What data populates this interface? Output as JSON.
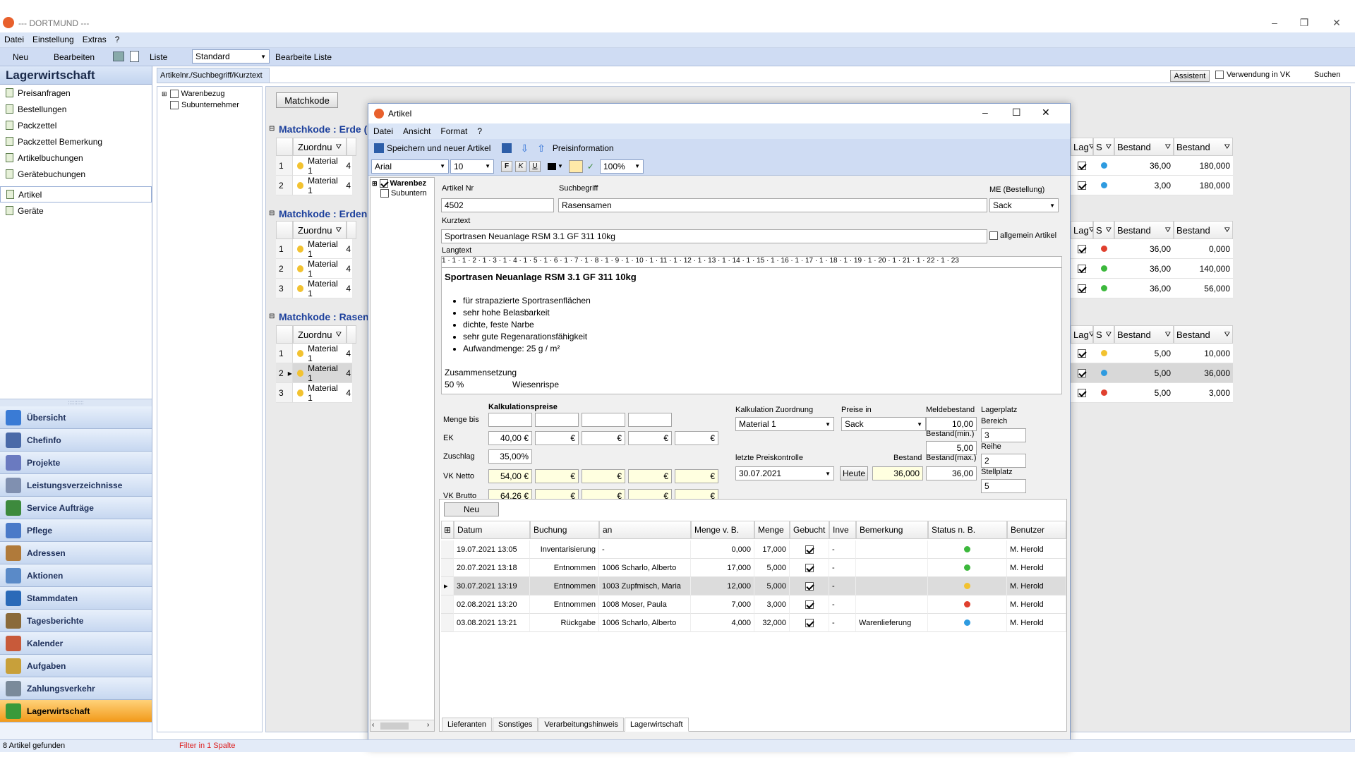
{
  "app": {
    "title": "--- DORTMUND ---",
    "menu": [
      "Datei",
      "Einstellung",
      "Extras",
      "?"
    ],
    "toolbar": {
      "new": "Neu",
      "edit": "Bearbeiten",
      "list": "Liste",
      "view_combo": "Standard",
      "edit_list": "Bearbeite Liste"
    },
    "window_controls": {
      "minimize": "–",
      "restore": "❐",
      "close": "✕"
    }
  },
  "left_panel": {
    "title": "Lagerwirtschaft",
    "tree": [
      "Preisanfragen",
      "Bestellungen",
      "Packzettel",
      "Packzettel Bemerkung",
      "Artikelbuchungen",
      "Gerätebuchungen",
      "Artikel",
      "Geräte"
    ],
    "selected_index": 6,
    "splitter": "::::::::::",
    "nav": [
      {
        "label": "Übersicht",
        "color": "#3a7bd5"
      },
      {
        "label": "Chefinfo",
        "color": "#4a6aa8"
      },
      {
        "label": "Projekte",
        "color": "#6a7ac0"
      },
      {
        "label": "Leistungsverzeichnisse",
        "color": "#8090b0"
      },
      {
        "label": "Service Aufträge",
        "color": "#3d8a3d"
      },
      {
        "label": "Pflege",
        "color": "#4a7ac8"
      },
      {
        "label": "Adressen",
        "color": "#b07a3a"
      },
      {
        "label": "Aktionen",
        "color": "#5a8ac8"
      },
      {
        "label": "Stammdaten",
        "color": "#2a6ab8"
      },
      {
        "label": "Tagesberichte",
        "color": "#8a6a3a"
      },
      {
        "label": "Kalender",
        "color": "#c85a3a"
      },
      {
        "label": "Aufgaben",
        "color": "#c8a03a"
      },
      {
        "label": "Zahlungsverkehr",
        "color": "#7a8a9a"
      },
      {
        "label": "Lagerwirtschaft",
        "color": "#3a9a3a"
      }
    ],
    "active_nav_index": 13
  },
  "search_bar": {
    "label": "Artikelnr./Suchbegriff/Kurztext",
    "assistant": "Assistent",
    "use_in_vk": "Verwendung in VK",
    "search": "Suchen"
  },
  "mid_tree": [
    "Warenbezug",
    "Subunternehmer"
  ],
  "main_grid": {
    "tab": "Matchkode",
    "right_headers": [
      "Lag",
      "S",
      "Bestand",
      "Bestand"
    ],
    "groups": [
      {
        "title": "Matchkode : Erde (",
        "header": "Zuordnu",
        "rows": [
          {
            "n": "1",
            "mat": "Material 1",
            "dot": "#f2c230",
            "s": "#2e9be0",
            "b1": "36,00",
            "b2": "180,000"
          },
          {
            "n": "2",
            "mat": "Material 1",
            "dot": "#f2c230",
            "s": "#2e9be0",
            "b1": "3,00",
            "b2": "180,000"
          }
        ]
      },
      {
        "title": "Matchkode : Erden",
        "header": "Zuordnu",
        "rows": [
          {
            "n": "1",
            "mat": "Material 1",
            "dot": "#f2c230",
            "s": "#e0402e",
            "b1": "36,00",
            "b2": "0,000"
          },
          {
            "n": "2",
            "mat": "Material 1",
            "dot": "#f2c230",
            "s": "#3cb83c",
            "b1": "36,00",
            "b2": "140,000"
          },
          {
            "n": "3",
            "mat": "Material 1",
            "dot": "#f2c230",
            "s": "#3cb83c",
            "b1": "36,00",
            "b2": "56,000"
          }
        ]
      },
      {
        "title": "Matchkode : Rasen",
        "header": "Zuordnu",
        "rows": [
          {
            "n": "1",
            "mat": "Material 1",
            "dot": "#f2c230",
            "s": "#f2c230",
            "b1": "5,00",
            "b2": "10,000"
          },
          {
            "n": "2",
            "mat": "Material 1",
            "dot": "#f2c230",
            "s": "#2e9be0",
            "b1": "5,00",
            "b2": "36,000"
          },
          {
            "n": "3",
            "mat": "Material 1",
            "dot": "#f2c230",
            "s": "#e0402e",
            "b1": "5,00",
            "b2": "3,000"
          }
        ]
      }
    ],
    "cut_col": "4"
  },
  "dialog": {
    "title": "Artikel",
    "menu": [
      "Datei",
      "Ansicht",
      "Format",
      "?"
    ],
    "toolbar": {
      "save_new": "Speichern und neuer Artikel",
      "price_info": "Preisinformation"
    },
    "format": {
      "font": "Arial",
      "size": "10",
      "bold": "F",
      "italic": "K",
      "underline": "U",
      "zoom": "100%"
    },
    "tree": [
      "Warenbez",
      "Subuntern"
    ],
    "fields": {
      "artikel_nr_label": "Artikel Nr",
      "artikel_nr": "4502",
      "suchbegriff_label": "Suchbegriff",
      "suchbegriff": "Rasensamen",
      "me_label": "ME (Bestellung)",
      "me": "Sack",
      "kurztext_label": "Kurztext",
      "kurztext": "Sportrasen Neuanlage RSM 3.1 GF 311 10kg",
      "allgemein": "allgemein Artikel",
      "langtext_label": "Langtext"
    },
    "ruler": "1 · 1 · 1 · 2 · 1 · 3 · 1 · 4 · 1 · 5 · 1 · 6 · 1 · 7 · 1 · 8 · 1 · 9 · 1 · 10 · 1 · 11 · 1 · 12 · 1 · 13 · 1 · 14 · 1 · 15 · 1 · 16 · 1 · 17 · 1 · 18 · 1 · 19 · 1 · 20 · 1 · 21 · 1 · 22 · 1 · 23",
    "langtext": {
      "heading": "Sportrasen Neuanlage RSM 3.1 GF 311 10kg",
      "bullets": [
        "für strapazierte Sportrasenflächen",
        "sehr hohe Belasbarkeit",
        "dichte, feste Narbe",
        "sehr gute Regenarationsfähigkeit",
        "Aufwandmenge: 25 g / m²"
      ],
      "section": "Zusammensetzung",
      "comp_pct": "50 %",
      "comp_name": "Wiesenrispe"
    },
    "calc": {
      "title": "Kalkulationspreise",
      "rows": [
        "Menge bis",
        "EK",
        "Zuschlag",
        "VK Netto",
        "VK Brutto"
      ],
      "ek": "40,00 €",
      "zuschlag": "35,00%",
      "vk_netto": "54,00 €",
      "vk_brutto": "64,26 €",
      "euro": "€",
      "kalk_label": "Kalkulation Zuordnung",
      "kalk": "Material 1",
      "preise_label": "Preise in",
      "preise": "Sack",
      "letzte_label": "letzte Preiskontrolle",
      "letzte": "30.07.2021",
      "heute": "Heute",
      "bestand_label": "Bestand",
      "bestand": "36,000",
      "melde_label": "Meldebestand",
      "melde": "10,00",
      "min_label": "Bestand(min.)",
      "min": "5,00",
      "max_label": "Bestand(max.)",
      "max": "36,00",
      "lager_label": "Lagerplatz",
      "bereich_label": "Bereich",
      "bereich": "3",
      "reihe_label": "Reihe",
      "reihe": "2",
      "stell_label": "Stellplatz",
      "stell": "5"
    },
    "bookings": {
      "new_btn": "Neu",
      "headers": [
        "Datum",
        "Buchung",
        "an",
        "Menge v. B.",
        "Menge",
        "Gebucht",
        "Inve",
        "Bemerkung",
        "Status n. B.",
        "Benutzer"
      ],
      "rows": [
        {
          "datum": "19.07.2021 13:05",
          "buchung": "Inventarisierung",
          "an": "-",
          "mvb": "0,000",
          "menge": "17,000",
          "inve": "-",
          "bem": "",
          "status": "#3cb83c",
          "user": "M. Herold"
        },
        {
          "datum": "20.07.2021 13:18",
          "buchung": "Entnommen",
          "an": "1006 Scharlo, Alberto",
          "mvb": "17,000",
          "menge": "5,000",
          "inve": "-",
          "bem": "",
          "status": "#3cb83c",
          "user": "M. Herold"
        },
        {
          "datum": "30.07.2021 13:19",
          "buchung": "Entnommen",
          "an": "1003 Zupfmisch, Maria",
          "mvb": "12,000",
          "menge": "5,000",
          "inve": "-",
          "bem": "",
          "status": "#f2c230",
          "user": "M. Herold"
        },
        {
          "datum": "02.08.2021 13:20",
          "buchung": "Entnommen",
          "an": "1008 Moser, Paula",
          "mvb": "7,000",
          "menge": "3,000",
          "inve": "-",
          "bem": "",
          "status": "#e0402e",
          "user": "M. Herold"
        },
        {
          "datum": "03.08.2021 13:21",
          "buchung": "Rückgabe",
          "an": "1006 Scharlo, Alberto",
          "mvb": "4,000",
          "menge": "32,000",
          "inve": "-",
          "bem": "Warenlieferung",
          "status": "#2e9be0",
          "user": "M. Herold"
        }
      ],
      "selected_row": 2
    },
    "tabs": [
      "Lieferanten",
      "Sonstiges",
      "Verarbeitungshinweis",
      "Lagerwirtschaft"
    ],
    "selected_tab": 3
  },
  "status": {
    "found": "8 Artikel gefunden",
    "filter": "Filter in 1 Spalte"
  }
}
